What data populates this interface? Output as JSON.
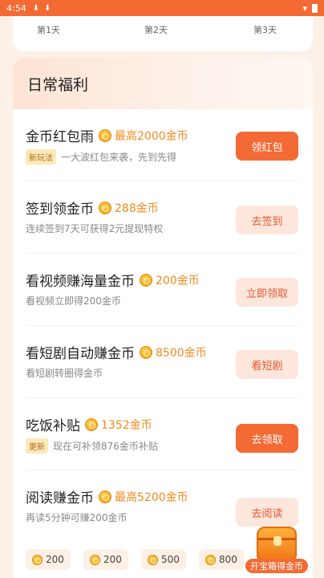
{
  "status_bar": {
    "time": "4:54",
    "icons": [
      "download-icon",
      "download-icon",
      "wifi-icon",
      "battery-icon"
    ]
  },
  "days": [
    "第1天",
    "第2天",
    "第3天"
  ],
  "section_title": "日常福利",
  "tasks": [
    {
      "title": "金币红包雨",
      "reward": "最高2000金币",
      "tag": "新玩法",
      "desc": "一大波红包来袭，先到先得",
      "button": "领红包",
      "button_style": "primary"
    },
    {
      "title": "签到领金币",
      "reward": "288金币",
      "tag": "",
      "desc": "连续签到7天可获得2元提现特权",
      "button": "去签到",
      "button_style": "soft"
    },
    {
      "title": "看视频赚海量金币",
      "reward": "200金币",
      "tag": "",
      "desc": "看视频立即得200金币",
      "button": "立即领取",
      "button_style": "soft"
    },
    {
      "title": "看短剧自动赚金币",
      "reward": "8500金币",
      "tag": "",
      "desc": "看短剧转圈得金币",
      "button": "看短剧",
      "button_style": "soft"
    },
    {
      "title": "吃饭补贴",
      "reward": "1352金币",
      "tag": "更新",
      "desc": "现在可补领876金币补贴",
      "button": "去领取",
      "button_style": "primary"
    },
    {
      "title": "阅读赚金币",
      "reward": "最高5200金币",
      "tag": "",
      "desc": "再读5分钟可赚200金币",
      "button": "去阅读",
      "button_style": "soft"
    }
  ],
  "reading_chips": [
    "200",
    "200",
    "500",
    "800"
  ],
  "treasure_label": "开宝箱得金币"
}
